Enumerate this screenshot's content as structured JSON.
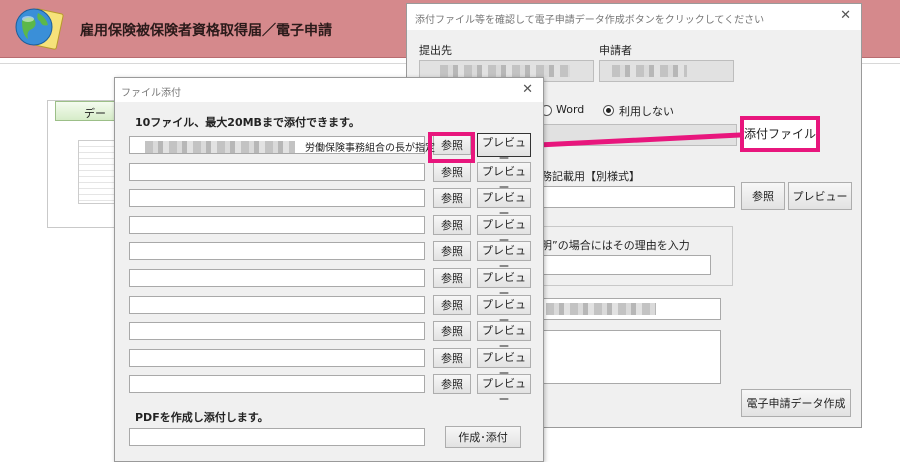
{
  "app": {
    "title": "雇用保険被保険者資格取得届／電子申請"
  },
  "background": {
    "data_tab_label": "デー"
  },
  "main_dialog": {
    "title": "添付ファイル等を確認して電子申請データ作成ボタンをクリックしてください",
    "submit_to_label": "提出先",
    "applicant_label": "申請者",
    "radio_word_label": "Word",
    "radio_none_label": "利用しない",
    "attach_file_button": "添付ファイル",
    "separate_form_label": "務記載用【別様式】",
    "browse_label": "参照",
    "preview_label": "プレビュー",
    "reason_label": "明”の場合にはその理由を入力",
    "create_data_button": "電子申請データ作成"
  },
  "file_dialog": {
    "title": "ファイル添付",
    "heading": "10ファイル、最大20MBまで添付できます。",
    "first_row_text": "労働保険事務組合の長が指定",
    "rows": [
      {
        "browse": "参照",
        "preview": "プレビュー"
      },
      {
        "browse": "参照",
        "preview": "プレビュー"
      },
      {
        "browse": "参照",
        "preview": "プレビュー"
      },
      {
        "browse": "参照",
        "preview": "プレビュー"
      },
      {
        "browse": "参照",
        "preview": "プレビュー"
      },
      {
        "browse": "参照",
        "preview": "プレビュー"
      },
      {
        "browse": "参照",
        "preview": "プレビュー"
      },
      {
        "browse": "参照",
        "preview": "プレビュー"
      },
      {
        "browse": "参照",
        "preview": "プレビュー"
      },
      {
        "browse": "参照",
        "preview": "プレビュー"
      }
    ],
    "pdf_heading": "PDFを作成し添付します。",
    "pdf_button": "作成･添付"
  },
  "colors": {
    "header": "#d5898c",
    "annotation": "#e8167d"
  }
}
